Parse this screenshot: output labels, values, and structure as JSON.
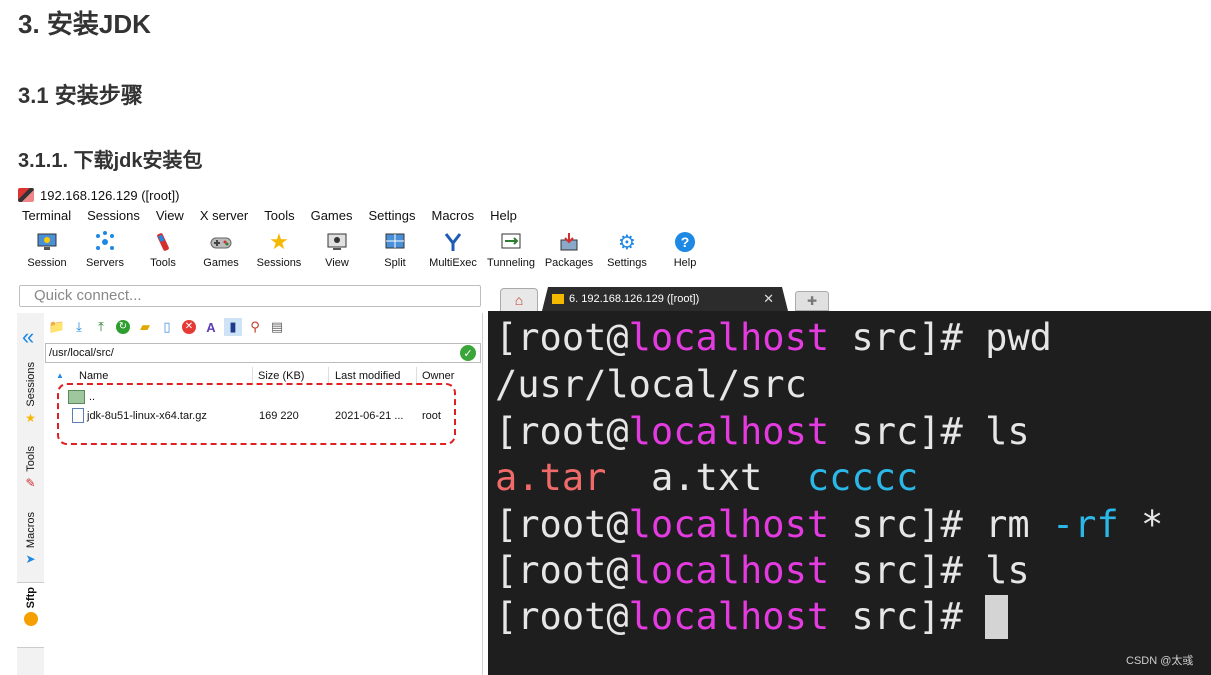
{
  "headings": {
    "h1": "3. 安装JDK",
    "h2": "3.1 安装步骤",
    "h3": "3.1.1. 下载jdk安装包"
  },
  "window": {
    "title": "192.168.126.129 ([root])"
  },
  "menu": [
    "Terminal",
    "Sessions",
    "View",
    "X server",
    "Tools",
    "Games",
    "Settings",
    "Macros",
    "Help"
  ],
  "toolbar": [
    {
      "label": "Session",
      "icon": "session-icon"
    },
    {
      "label": "Servers",
      "icon": "servers-icon"
    },
    {
      "label": "Tools",
      "icon": "tools-icon"
    },
    {
      "label": "Games",
      "icon": "games-icon"
    },
    {
      "label": "Sessions",
      "icon": "star-icon"
    },
    {
      "label": "View",
      "icon": "view-icon"
    },
    {
      "label": "Split",
      "icon": "split-icon"
    },
    {
      "label": "MultiExec",
      "icon": "multiexec-icon"
    },
    {
      "label": "Tunneling",
      "icon": "tunneling-icon"
    },
    {
      "label": "Packages",
      "icon": "packages-icon"
    },
    {
      "label": "Settings",
      "icon": "settings-icon"
    },
    {
      "label": "Help",
      "icon": "help-icon"
    }
  ],
  "quick_connect": {
    "placeholder": "Quick connect..."
  },
  "tabs": {
    "session_title": "6. 192.168.126.129 ([root])"
  },
  "side_tabs": [
    "Sessions",
    "Tools",
    "Macros",
    "Sftp"
  ],
  "sftp": {
    "path": "/usr/local/src/",
    "columns": [
      "Name",
      "Size (KB)",
      "Last modified",
      "Owner"
    ],
    "rows": [
      {
        "name": "..",
        "size": "",
        "modified": "",
        "owner": ""
      },
      {
        "name": "jdk-8u51-linux-x64.tar.gz",
        "size": "169 220",
        "modified": "2021-06-21 ...",
        "owner": "root"
      }
    ]
  },
  "terminal": {
    "prompt_user": "[root@",
    "prompt_host": "localhost",
    "prompt_tail": " src]# ",
    "lines": [
      {
        "cmd": "pwd"
      },
      {
        "output": "/usr/local/src"
      },
      {
        "cmd": "ls"
      },
      {
        "ls": [
          "a.tar",
          "a.txt",
          "ccccc"
        ]
      },
      {
        "cmd_pre": "rm ",
        "cmd_opt": "-rf",
        "cmd_post": " *"
      },
      {
        "cmd": "ls"
      },
      {
        "cmd": ""
      }
    ],
    "colors": {
      "host": "#e33be0",
      "archive": "#f16a6a",
      "dir": "#2bb7e8",
      "bg": "#1e1e1e"
    }
  },
  "watermark": "CSDN @太彧"
}
